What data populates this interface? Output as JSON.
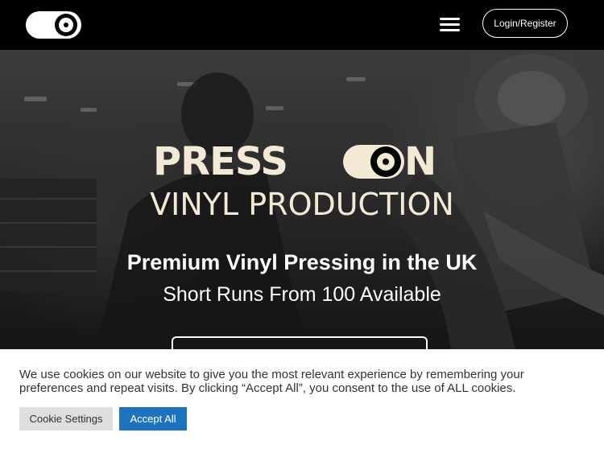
{
  "header": {
    "logo_icon": "record-toggle-logo",
    "menu_icon": "hamburger-menu-icon",
    "login_label": "Login/Register"
  },
  "hero": {
    "brand_word_1": "PRESS",
    "brand_word_2": "N",
    "brand_subtitle": "VINYL PRODUCTION",
    "headline": "Premium Vinyl Pressing in the UK",
    "subline": "Short Runs From 100 Available",
    "brand_color": "#f3ead6"
  },
  "cookie": {
    "text": "We use cookies on our website to give you the most relevant experience by remembering your preferences and repeat visits. By clicking “Accept All”, you consent to the use of ALL cookies.",
    "settings_label": "Cookie Settings",
    "accept_label": "Accept All",
    "accept_color": "#1e73be"
  }
}
